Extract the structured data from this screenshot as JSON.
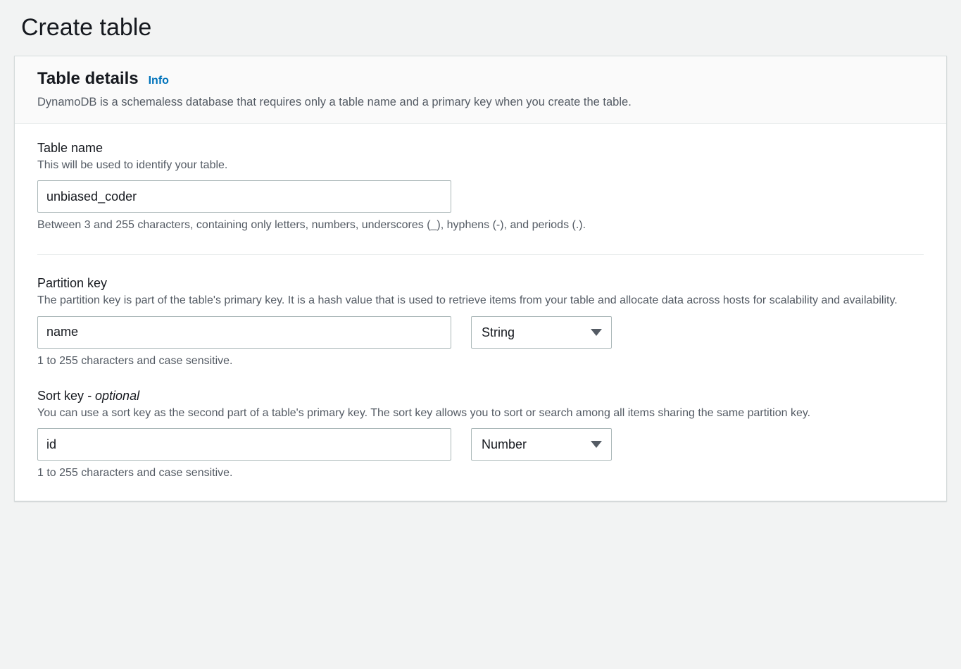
{
  "page": {
    "title": "Create table"
  },
  "card": {
    "title": "Table details",
    "info_label": "Info",
    "description": "DynamoDB is a schemaless database that requires only a table name and a primary key when you create the table."
  },
  "table_name": {
    "label": "Table name",
    "hint": "This will be used to identify your table.",
    "value": "unbiased_coder",
    "help": "Between 3 and 255 characters, containing only letters, numbers, underscores (_), hyphens (-), and periods (.)."
  },
  "partition_key": {
    "label": "Partition key",
    "hint": "The partition key is part of the table's primary key. It is a hash value that is used to retrieve items from your table and allocate data across hosts for scalability and availability.",
    "value": "name",
    "type_value": "String",
    "help": "1 to 255 characters and case sensitive."
  },
  "sort_key": {
    "label_main": "Sort key",
    "label_optional": " - optional",
    "hint": "You can use a sort key as the second part of a table's primary key. The sort key allows you to sort or search among all items sharing the same partition key.",
    "value": "id",
    "type_value": "Number",
    "help": "1 to 255 characters and case sensitive."
  }
}
